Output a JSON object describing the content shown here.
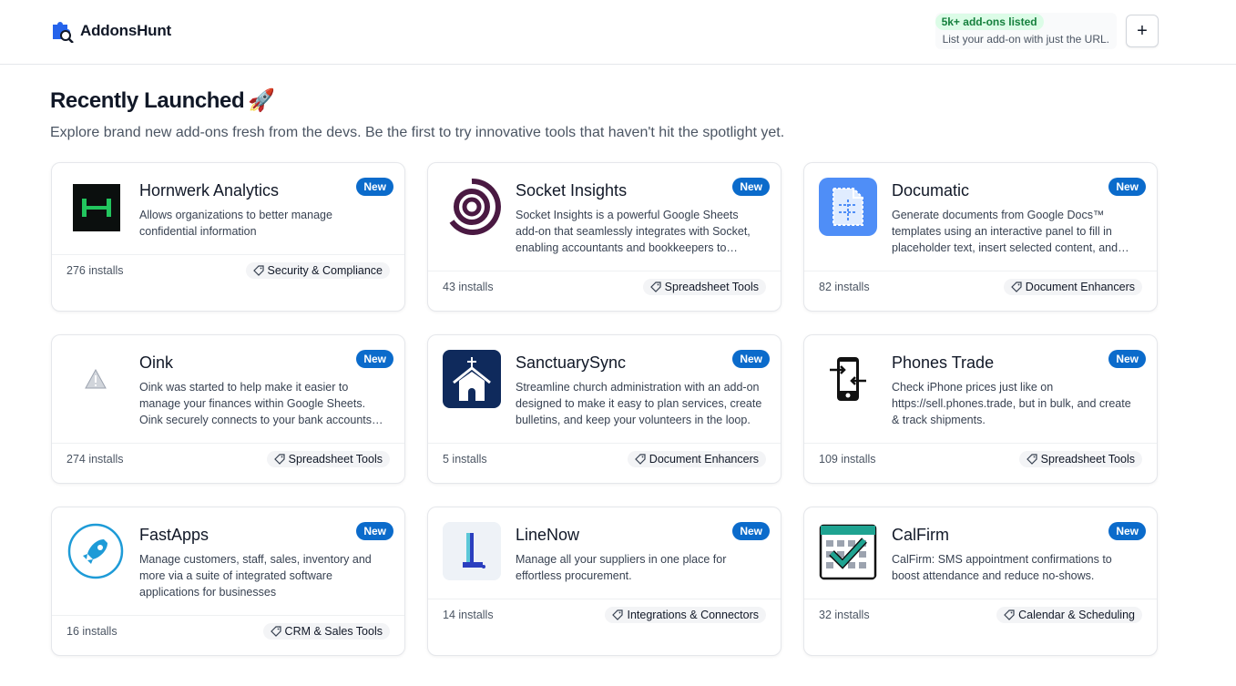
{
  "header": {
    "logo_text": "AddonsHunt",
    "badge": "5k+ add-ons listed",
    "subtitle": "List your add-on with just the URL.",
    "add_button": "+"
  },
  "hero": {
    "title": "Recently Launched",
    "title_emoji": "🚀",
    "subtitle": "Explore brand new add-ons fresh from the devs. Be the first to try innovative tools that haven't hit the spotlight yet."
  },
  "new_label": "New",
  "cards": [
    {
      "name": "Hornwerk Analytics",
      "desc": "Allows organizations to better manage confidential information",
      "installs": "276 installs",
      "category": "Security & Compliance"
    },
    {
      "name": "Socket Insights",
      "desc": "Socket Insights is a powerful Google Sheets add-on that seamlessly integrates with Socket, enabling accountants and bookkeepers to…",
      "installs": "43 installs",
      "category": "Spreadsheet Tools"
    },
    {
      "name": "Documatic",
      "desc": "Generate documents from Google Docs™ templates using an interactive panel to fill in placeholder text, insert selected content, and…",
      "installs": "82 installs",
      "category": "Document Enhancers"
    },
    {
      "name": "Oink",
      "desc": "Oink was started to help make it easier to manage your finances within Google Sheets. Oink securely connects to your bank accounts and…",
      "installs": "274 installs",
      "category": "Spreadsheet Tools"
    },
    {
      "name": "SanctuarySync",
      "desc": "Streamline church administration with an add-on designed to make it easy to plan services, create bulletins, and keep your volunteers in the loop.",
      "installs": "5 installs",
      "category": "Document Enhancers"
    },
    {
      "name": "Phones Trade",
      "desc": "Check iPhone prices just like on https://sell.phones.trade, but in bulk, and create & track shipments.",
      "installs": "109 installs",
      "category": "Spreadsheet Tools"
    },
    {
      "name": "FastApps",
      "desc": "Manage customers, staff, sales, inventory and more via a suite of integrated software applications for businesses",
      "installs": "16 installs",
      "category": "CRM & Sales Tools"
    },
    {
      "name": "LineNow",
      "desc": "Manage all your suppliers in one place for effortless procurement.",
      "installs": "14 installs",
      "category": "Integrations & Connectors"
    },
    {
      "name": "CalFirm",
      "desc": "CalFirm: SMS appointment confirmations to boost attendance and reduce no-shows.",
      "installs": "32 installs",
      "category": "Calendar & Scheduling"
    }
  ]
}
